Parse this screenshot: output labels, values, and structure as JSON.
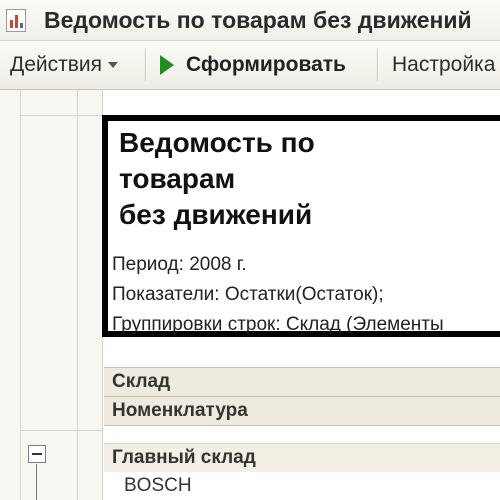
{
  "window": {
    "title": "Ведомость по товарам без движений"
  },
  "toolbar": {
    "actions_label": "Действия",
    "generate_label": "Сформировать",
    "settings_label": "Настройка"
  },
  "report": {
    "title_lines": [
      "Ведомость по",
      "товарам",
      "без движений"
    ],
    "period": "Период: 2008 г.",
    "indicators": "Показатели: Остатки(Остаток);",
    "groupings": "Группировки строк: Склад (Элементы",
    "header_rows": [
      "Склад",
      "Номенклатура"
    ],
    "data_rows": [
      "Главный склад",
      "BOSCH"
    ]
  },
  "colors": {
    "generate_icon": "#1f8f1f",
    "header_bg": "#efeade"
  }
}
